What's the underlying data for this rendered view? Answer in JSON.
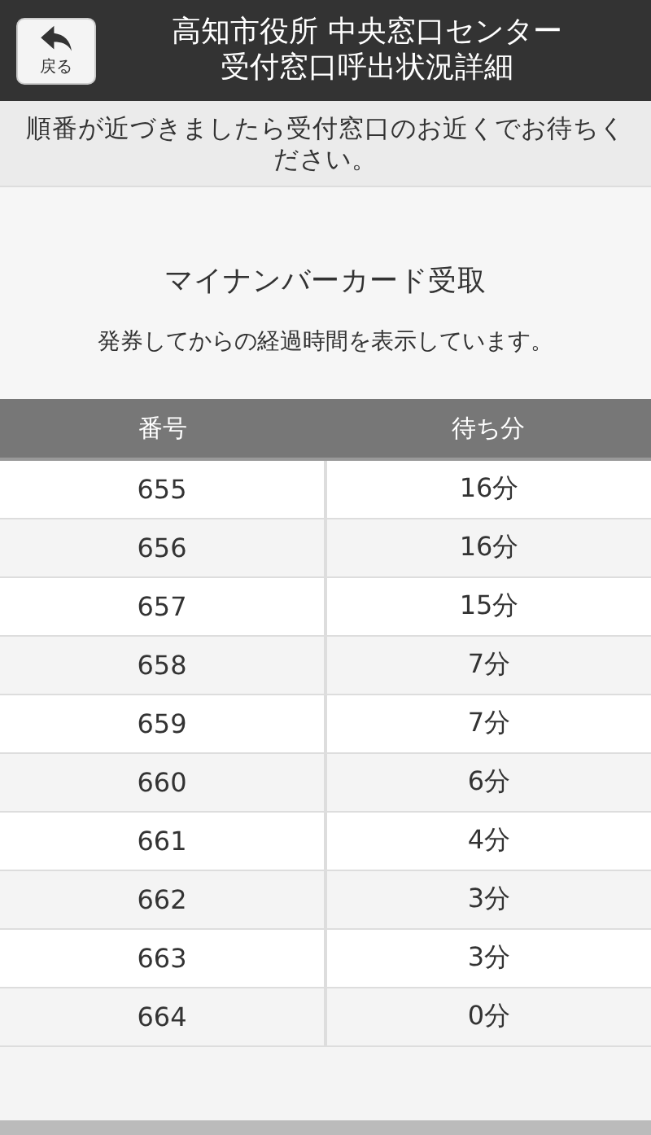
{
  "header": {
    "back_button": "戻る",
    "title_lines": [
      "高知市役所 中央窓口センター",
      "受付窓口呼出状況詳細"
    ]
  },
  "notice": "順番が近づきましたら受付窓口のお近くでお待ちください。",
  "section": {
    "title": "マイナンバーカード受取",
    "subtitle": "発券してからの経過時間を表示しています。"
  },
  "table": {
    "columns": [
      "番号",
      "待ち分"
    ],
    "rows": [
      [
        "655",
        "16分"
      ],
      [
        "656",
        "16分"
      ],
      [
        "657",
        "15分"
      ],
      [
        "658",
        "7分"
      ],
      [
        "659",
        "7分"
      ],
      [
        "660",
        "6分"
      ],
      [
        "661",
        "4分"
      ],
      [
        "662",
        "3分"
      ],
      [
        "663",
        "3分"
      ],
      [
        "664",
        "0分"
      ]
    ]
  }
}
